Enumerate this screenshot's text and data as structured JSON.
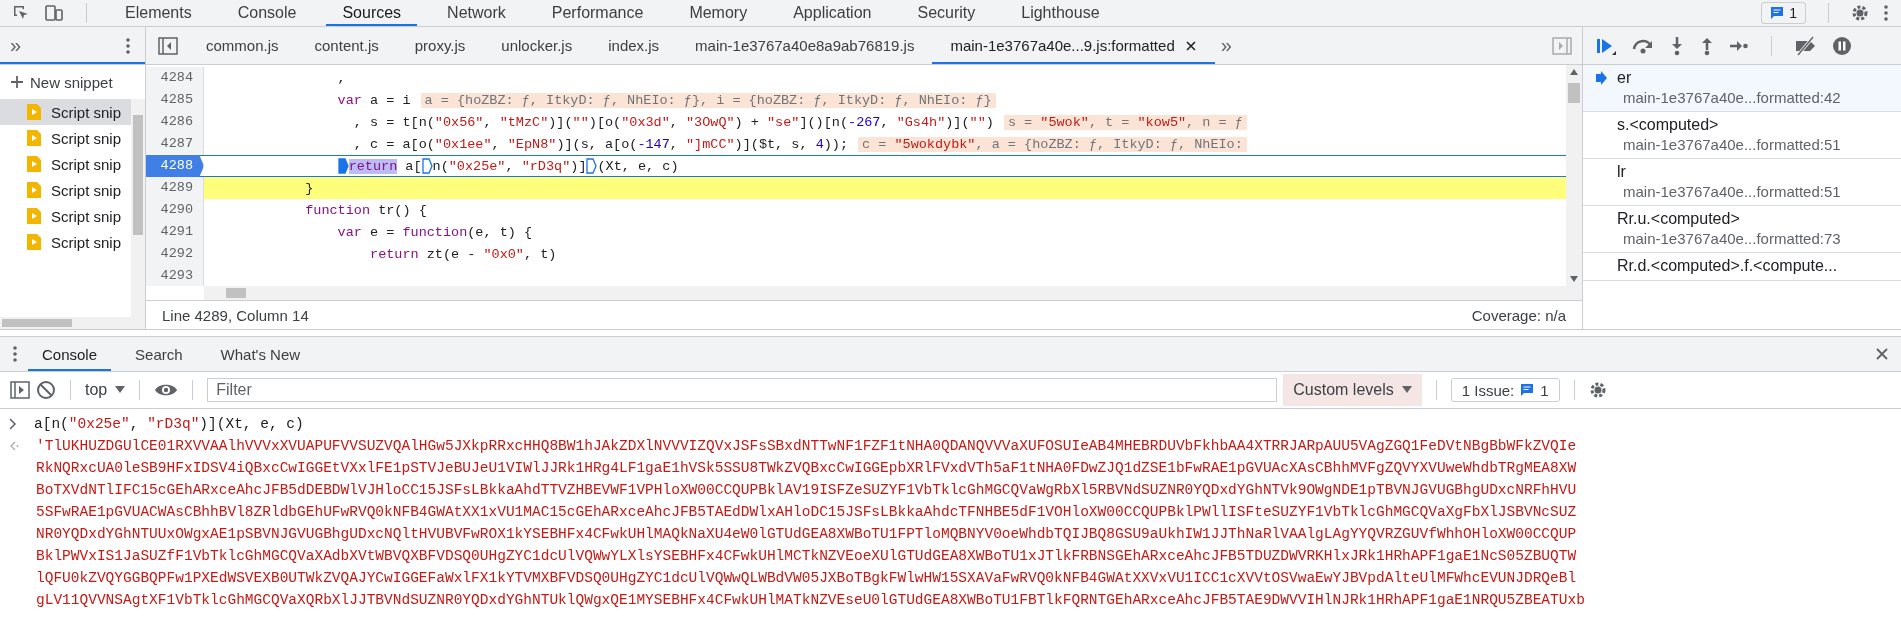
{
  "main_tabs": [
    {
      "label": "Elements",
      "selected": false
    },
    {
      "label": "Console",
      "selected": false
    },
    {
      "label": "Sources",
      "selected": true
    },
    {
      "label": "Network",
      "selected": false
    },
    {
      "label": "Performance",
      "selected": false
    },
    {
      "label": "Memory",
      "selected": false
    },
    {
      "label": "Application",
      "selected": false
    },
    {
      "label": "Security",
      "selected": false
    },
    {
      "label": "Lighthouse",
      "selected": false
    }
  ],
  "issues_badge": "1",
  "navigator": {
    "more": "»",
    "new_snippet": "New snippet",
    "items": [
      {
        "label": "Script snip",
        "selected": true
      },
      {
        "label": "Script snip",
        "selected": false
      },
      {
        "label": "Script snip",
        "selected": false
      },
      {
        "label": "Script snip",
        "selected": false
      },
      {
        "label": "Script snip",
        "selected": false
      },
      {
        "label": "Script snip",
        "selected": false
      }
    ]
  },
  "file_tabs": [
    {
      "label": "common.js",
      "selected": false,
      "closable": false
    },
    {
      "label": "content.js",
      "selected": false,
      "closable": false
    },
    {
      "label": "proxy.js",
      "selected": false,
      "closable": false
    },
    {
      "label": "unlocker.js",
      "selected": false,
      "closable": false
    },
    {
      "label": "index.js",
      "selected": false,
      "closable": false
    },
    {
      "label": "main-1e3767a40e8a9ab76819.js",
      "selected": false,
      "closable": false
    },
    {
      "label": "main-1e3767a40e...9.js:formatted",
      "selected": true,
      "closable": true
    }
  ],
  "file_tabs_more": "»",
  "editor": {
    "lines": [
      {
        "number": "4284",
        "breakpoint": false,
        "paused": false,
        "code": [
          {
            "text": "                ,",
            "kind": "plain"
          }
        ]
      },
      {
        "number": "4285",
        "breakpoint": false,
        "paused": false,
        "code": [
          {
            "text": "                var",
            "kind": "keyword"
          },
          {
            "text": " a = i",
            "kind": "plain"
          }
        ],
        "annotation": [
          {
            "text": "a = {hoZBZ: ƒ, ItkyD: ƒ, NhEIo: ƒ}, i = {hoZBZ: ƒ, ItkyD: ƒ, NhEIo: ƒ}",
            "kind": "value"
          }
        ]
      },
      {
        "number": "4286",
        "breakpoint": false,
        "paused": false,
        "code": [
          {
            "text": "                  , s = t[n(",
            "kind": "plain"
          },
          {
            "text": "\"0x56\"",
            "kind": "string"
          },
          {
            "text": ", ",
            "kind": "plain"
          },
          {
            "text": "\"tMzC\"",
            "kind": "string"
          },
          {
            "text": ")](",
            "kind": "plain"
          },
          {
            "text": "\"\"",
            "kind": "string"
          },
          {
            "text": ")[o(",
            "kind": "plain"
          },
          {
            "text": "\"0x3d\"",
            "kind": "string"
          },
          {
            "text": ", ",
            "kind": "plain"
          },
          {
            "text": "\"3OwQ\"",
            "kind": "string"
          },
          {
            "text": ") + ",
            "kind": "plain"
          },
          {
            "text": "\"se\"",
            "kind": "string"
          },
          {
            "text": "]()[n(",
            "kind": "plain"
          },
          {
            "text": "-267",
            "kind": "number"
          },
          {
            "text": ", ",
            "kind": "plain"
          },
          {
            "text": "\"Gs4h\"",
            "kind": "string"
          },
          {
            "text": ")](",
            "kind": "plain"
          },
          {
            "text": "\"\"",
            "kind": "string"
          },
          {
            "text": ")",
            "kind": "plain"
          }
        ],
        "annotation": [
          {
            "text": "s = ",
            "kind": "value"
          },
          {
            "text": "\"5wok\"",
            "kind": "value_string"
          },
          {
            "text": ", t = ",
            "kind": "value"
          },
          {
            "text": "\"kow5\"",
            "kind": "value_string"
          },
          {
            "text": ", n = ƒ",
            "kind": "value"
          }
        ]
      },
      {
        "number": "4287",
        "breakpoint": false,
        "paused": false,
        "code": [
          {
            "text": "                  , c = a[o(",
            "kind": "plain"
          },
          {
            "text": "\"0x1ee\"",
            "kind": "string"
          },
          {
            "text": ", ",
            "kind": "plain"
          },
          {
            "text": "\"EpN8\"",
            "kind": "string"
          },
          {
            "text": ")](s, a[o(",
            "kind": "plain"
          },
          {
            "text": "-147",
            "kind": "number"
          },
          {
            "text": ", ",
            "kind": "plain"
          },
          {
            "text": "\"]mCC\"",
            "kind": "string"
          },
          {
            "text": ")]($t, s, ",
            "kind": "plain"
          },
          {
            "text": "4",
            "kind": "number"
          },
          {
            "text": "));",
            "kind": "plain"
          }
        ],
        "annotation": [
          {
            "text": "c = ",
            "kind": "value"
          },
          {
            "text": "\"5wokdybk\"",
            "kind": "value_string"
          },
          {
            "text": ", a = {hoZBZ: ƒ, ItkyD: ƒ, NhEIo:",
            "kind": "value"
          }
        ]
      },
      {
        "number": "4288",
        "breakpoint": true,
        "paused": false,
        "code": [
          {
            "text": "                return",
            "kind": "selected_keyword",
            "marker": true,
            "marker_active": true
          },
          {
            "text": " a[",
            "kind": "plain"
          },
          {
            "text": "n(",
            "kind": "plain",
            "marker": true,
            "marker_active": false
          },
          {
            "text": "\"0x25e\"",
            "kind": "string"
          },
          {
            "text": ", ",
            "kind": "plain"
          },
          {
            "text": "\"rD3q\"",
            "kind": "string"
          },
          {
            "text": ")]",
            "kind": "plain"
          },
          {
            "text": "(Xt, e, c)",
            "kind": "plain",
            "marker": true,
            "marker_active": false
          }
        ]
      },
      {
        "number": "4289",
        "breakpoint": false,
        "paused": true,
        "code": [
          {
            "text": "            }",
            "kind": "plain"
          }
        ]
      },
      {
        "number": "4290",
        "breakpoint": false,
        "paused": false,
        "code": [
          {
            "text": "            function",
            "kind": "keyword"
          },
          {
            "text": " tr() {",
            "kind": "plain"
          }
        ]
      },
      {
        "number": "4291",
        "breakpoint": false,
        "paused": false,
        "code": [
          {
            "text": "                var",
            "kind": "keyword"
          },
          {
            "text": " e = ",
            "kind": "plain"
          },
          {
            "text": "function",
            "kind": "keyword"
          },
          {
            "text": "(e, t) {",
            "kind": "plain"
          }
        ]
      },
      {
        "number": "4292",
        "breakpoint": false,
        "paused": false,
        "code": [
          {
            "text": "                    return",
            "kind": "keyword"
          },
          {
            "text": " zt(e - ",
            "kind": "plain"
          },
          {
            "text": "\"0x0\"",
            "kind": "string"
          },
          {
            "text": ", t)",
            "kind": "plain"
          }
        ]
      },
      {
        "number": "4293",
        "breakpoint": false,
        "paused": false
      }
    ]
  },
  "status_bar": {
    "position": "Line 4289, Column 14",
    "coverage": "Coverage: n/a"
  },
  "call_stack": [
    {
      "name": "er",
      "location": "main-1e3767a40e...formatted:42",
      "selected": true
    },
    {
      "name": "s.<computed>",
      "location": "main-1e3767a40e...formatted:51",
      "selected": false
    },
    {
      "name": "lr",
      "location": "main-1e3767a40e...formatted:51",
      "selected": false
    },
    {
      "name": "Rr.u.<computed>",
      "location": "main-1e3767a40e...formatted:73",
      "selected": false
    },
    {
      "name": "Rr.d.<computed>.f.<compute...",
      "selected": false
    }
  ],
  "drawer_tabs": [
    {
      "label": "Console",
      "selected": true
    },
    {
      "label": "Search",
      "selected": false
    },
    {
      "label": "What's New",
      "selected": false
    }
  ],
  "console_toolbar": {
    "context": "top",
    "filter_placeholder": "Filter",
    "levels": "Custom levels",
    "issues_label": "1 Issue:",
    "issues_count": "1"
  },
  "console": {
    "input": [
      {
        "text": "a[n(",
        "kind": "plain"
      },
      {
        "text": "\"0x25e\"",
        "kind": "string"
      },
      {
        "text": ", ",
        "kind": "plain"
      },
      {
        "text": "\"rD3q\"",
        "kind": "string"
      },
      {
        "text": ")](Xt, e, c)",
        "kind": "plain"
      }
    ],
    "output_lines": [
      "'TlUKHUZDGUlCE01RXVVAAlhVVVxXVUAPUFVVSUZVQAlHGw5JXkpRRxcHHQ8BW1hJAkZDXlNVVVIZQVxJSFsSBxdNTTwNF1FZF1tNHA0QDANQVVVaXUFOSUIeAB4MHEBRDUVbFkhbAA4XTRRJARpAUU5VAgZGQ1FeDVtNBgBbWFkZVQIe",
      "RkNQRxcUA0leSB9HFxIDSV4iQBxcCwIGGEtVXxlFE1pSTVJeBUJeU1VIWlJJRk1HRg4LF1gaE1hVSk5SSU8TWkZVQBxcCwIGGEpbXRlFVxdVTh5aF1tNHA0FDwZJQ1dZSE1bFwRAE1pGVUAcXAsCBhhMVFgZQVYXVUweWhdbTRgMEA8XW",
      "BoTXVdNTlIFC15cGEhARxceAhcJFB5dDEBDWlVJHloCC15JSFsLBkkaAhdTTVZHBEVWF1VPHloXW00CCQUPBklAV19ISFZeSUZYF1VbTklcGhMGCQVaWgRbXl5RBVNdSUZNR0YQDxdYGhNTVk9OWgNDE1pTBVNJGVUGBhgUDxcNRFhHVU",
      "5SFwRAE1pGVUACWAsCBhhBVl8ZRldbGEhUFwRVQ0kNFB4GWAtXX1xVU1MAC15cGEhARxceAhcJFB5TAEdDWlxAHloDC15JSFsLBkkaAhdcTFNHBE5dF1VOHloXW00CCQUPBklPWllISFteSUZYF1VbTklcGhMGCQVaXgFbXlJSBVNcSUZ",
      "NR0YQDxdYGhNTUUxOWgxAE1pSBVNJGVUGBhgUDxcNQltHVUBVFwROX1kYSEBHFx4CFwkUHlMAQkNaXU4eW0lGTUdGEA8XWBoTU1FPTloMQBNYV0oeWhdbTQIJBQ8GSU9aUkhIW1JJThNaRlVAAlgLAgYYQVRZGUVfWhhOHloXW00CCQUP",
      "BklPWVxIS1JaSUZfF1VbTklcGhMGCQVaXAdbXVtWBVQXBFVDSQ0UHgZYC1dcUlVQWwYLXlsYSEBHFx4CFwkUHlMCTkNZVEoeXUlGTUdGEA8XWBoTU1xJTlkFRBNSGEhARxceAhcJFB5TDUZDWVRKHlxJRk1HRhAPF1gaE1NcS05ZBUQTW",
      "lQFU0kZVQYGGBQPFw1PXEdWSVEXB0UTWkZVQAJYCwIGGEFaWxlFX1kYTVMXBFVDSQ0UHgZYC1dcUlVQWwQLWBdVW05JXBoTBgkFWlwHW15SXAVaFwRVQ0kNFB4GWAtXXVxVU1ICC1cXVVtOSVwaEwYJBVpdAlteUlMFWhcEVUNJDRQeBl",
      "gLV11QVVNSAgtXF1VbTklcGhMGCQVaXQRbXlJJTBVNdSUZNR0YQDxdYGhNTUklQWgxQE1MYSEBHFx4CFwkUHlMATkNZVEseU0lGTUdGEA8XWBoTU1FBTlkFQRNTGEhARxceAhcJFB5TAE9DWVVIHlNJRk1HRhAPF1gaE1NRQU5ZBEATUxb"
    ]
  }
}
